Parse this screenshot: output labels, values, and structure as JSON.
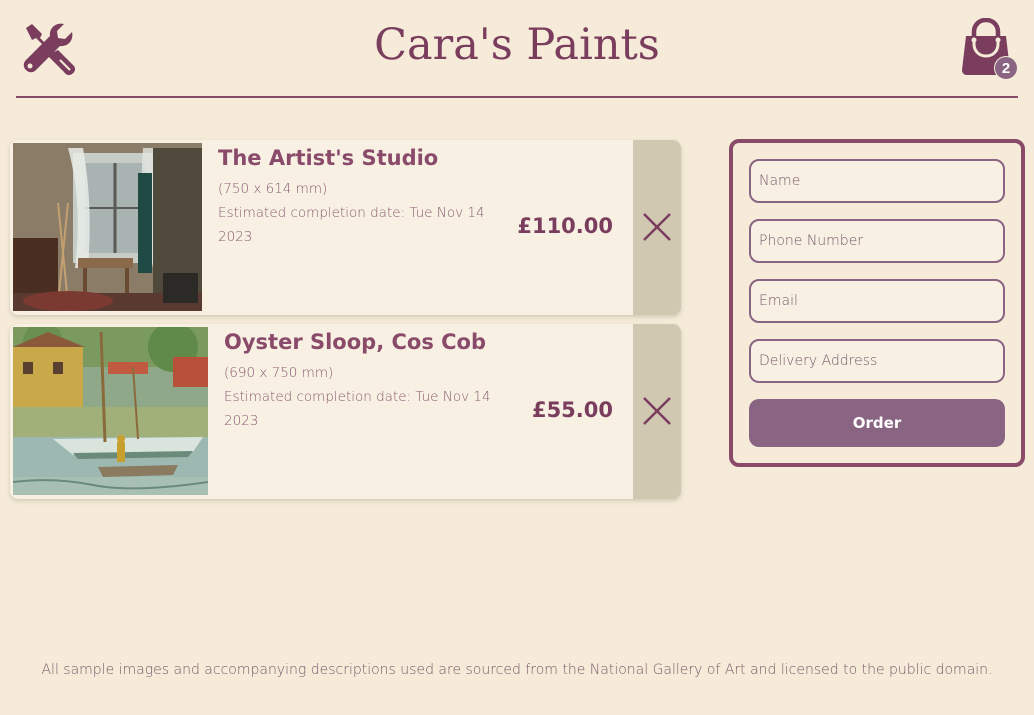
{
  "header": {
    "title": "Cara's Paints",
    "tools_icon": "tools-icon",
    "bag_icon": "shopping-bag-icon",
    "bag_count": "2"
  },
  "cart": {
    "items": [
      {
        "title": "The Artist's Studio",
        "size": "(750 x 614 mm)",
        "eta_line1": "Estimated completion date: Tue Nov 14",
        "eta_line2": "2023",
        "price": "£110.00",
        "remove_icon": "close-icon"
      },
      {
        "title": "Oyster Sloop, Cos Cob",
        "size": "(690 x 750 mm)",
        "eta_line1": "Estimated completion date: Tue Nov 14",
        "eta_line2": "2023",
        "price": "£55.00",
        "remove_icon": "close-icon"
      }
    ]
  },
  "form": {
    "name_placeholder": "Name",
    "phone_placeholder": "Phone Number",
    "email_placeholder": "Email",
    "address_placeholder": "Delivery Address",
    "order_label": "Order"
  },
  "footer": {
    "text": "All sample images and accompanying descriptions used are sourced from the National Gallery of Art and licensed to the public domain."
  },
  "colors": {
    "background": "#f5ebd8",
    "accent": "#7a3d5e",
    "button": "#8a6483",
    "card": "#f7f0e3",
    "remove_bg": "#d1c8b2"
  }
}
